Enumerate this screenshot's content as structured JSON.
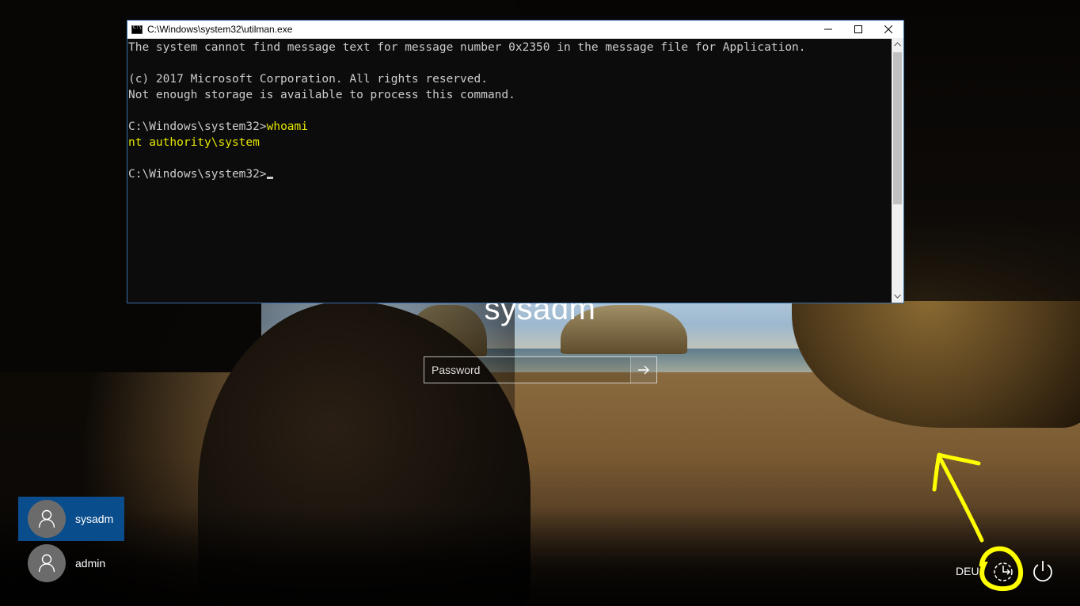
{
  "console": {
    "title": "C:\\Windows\\system32\\utilman.exe",
    "lines": [
      {
        "text": "The system cannot find message text for message number 0x2350 in the message file for Application."
      },
      {
        "text": ""
      },
      {
        "text": "(c) 2017 Microsoft Corporation. All rights reserved."
      },
      {
        "text": "Not enough storage is available to process this command."
      },
      {
        "text": ""
      }
    ],
    "prompt1": "C:\\Windows\\system32>",
    "command1": "whoami",
    "output1": "nt authority\\system",
    "prompt2": "C:\\Windows\\system32>"
  },
  "login": {
    "username": "sysadm",
    "password_placeholder": "Password"
  },
  "users": [
    {
      "name": "sysadm",
      "selected": true
    },
    {
      "name": "admin",
      "selected": false
    }
  ],
  "language": "DEU",
  "colors": {
    "selected_user_tile": "#0a4d8c",
    "annotation": "#ffff00",
    "console_highlight": "#e6e600"
  }
}
